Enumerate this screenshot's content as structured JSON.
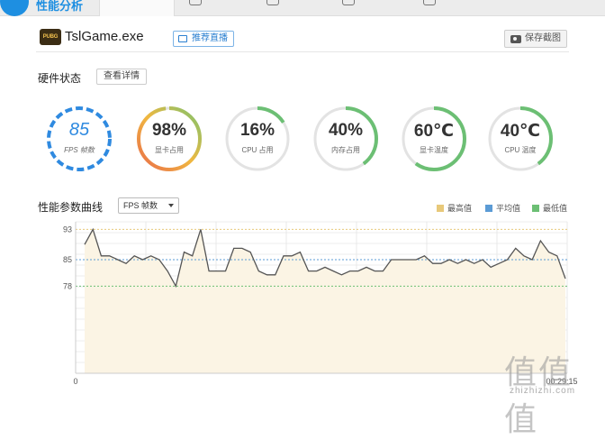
{
  "app": {
    "title": "性能分析"
  },
  "game": {
    "icon_text": "PUBG",
    "name": "TslGame.exe",
    "recommend_label": "推荐直播",
    "save_label": "保存截图"
  },
  "hardware": {
    "title": "硬件状态",
    "details_label": "查看详情",
    "gauges": [
      {
        "value": "85",
        "label": "FPS 帧数",
        "fraction": 0.85,
        "type": "fps"
      },
      {
        "value": "98%",
        "label": "显卡占用",
        "fraction": 0.98,
        "type": "gradient"
      },
      {
        "value": "16%",
        "label": "CPU 占用",
        "fraction": 0.16,
        "type": "green"
      },
      {
        "value": "40%",
        "label": "内存占用",
        "fraction": 0.4,
        "type": "green"
      },
      {
        "value": "60℃",
        "label": "显卡温度",
        "fraction": 0.6,
        "type": "green"
      },
      {
        "value": "40℃",
        "label": "CPU 温度",
        "fraction": 0.4,
        "type": "green"
      }
    ]
  },
  "curve": {
    "title": "性能参数曲线",
    "select_value": "FPS 帧数",
    "legend": [
      {
        "label": "最高值",
        "color": "#e8c97a"
      },
      {
        "label": "平均值",
        "color": "#5b9bd5"
      },
      {
        "label": "最低值",
        "color": "#6cbf74"
      }
    ]
  },
  "chart_data": {
    "type": "line",
    "series": [
      {
        "values": [
          89,
          93,
          86,
          86,
          85,
          84,
          86,
          85,
          86,
          85,
          82,
          78,
          87,
          86,
          93,
          82,
          82,
          82,
          88,
          88,
          87,
          82,
          81,
          81,
          86,
          86,
          87,
          82,
          82,
          83,
          82,
          81,
          82,
          82,
          83,
          82,
          82,
          85,
          85,
          85,
          85,
          86,
          84,
          84,
          85,
          84,
          85,
          84,
          85,
          83,
          84,
          85,
          88,
          86,
          85,
          90,
          87,
          86,
          80
        ]
      }
    ],
    "yticks": [
      93,
      85,
      78
    ],
    "max": 93,
    "avg": 85,
    "min": 78,
    "x_start_label": "0",
    "x_end_label": "00:29:15",
    "ylim": [
      55,
      95
    ]
  },
  "watermark": {
    "text": "值值值",
    "url": "zhizhizhi.com"
  }
}
